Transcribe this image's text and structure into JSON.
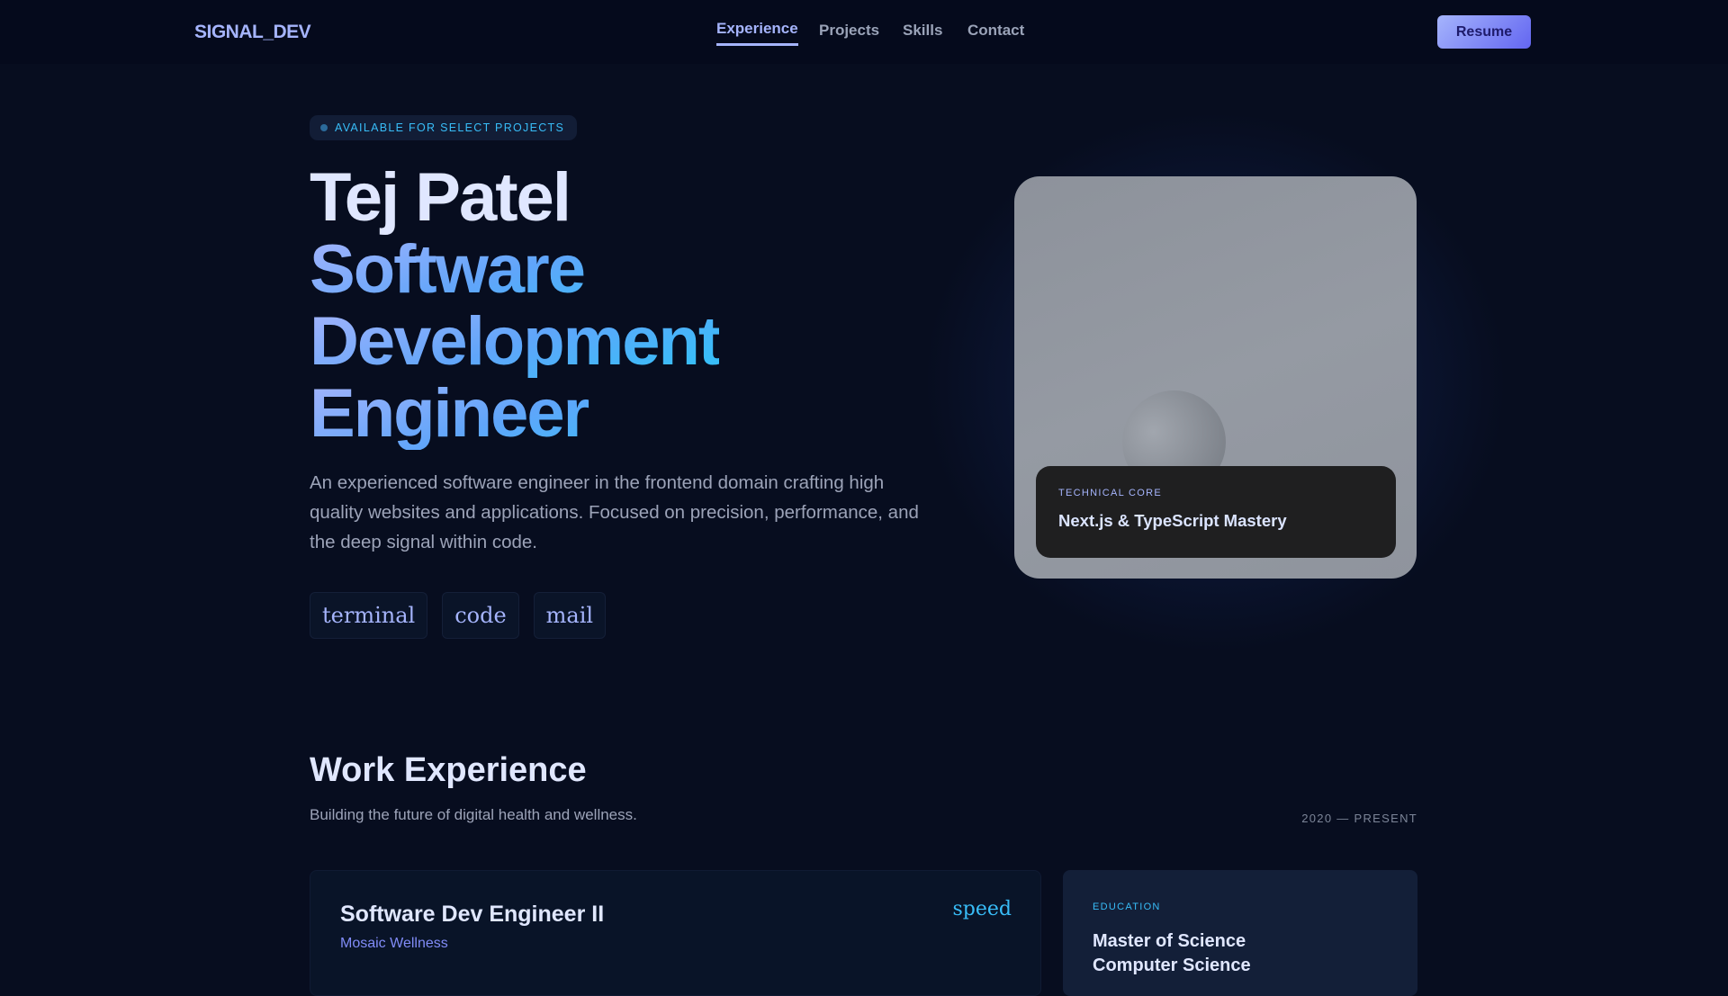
{
  "nav": {
    "logo": "SIGNAL_DEV",
    "links": [
      {
        "label": "Experience",
        "active": true
      },
      {
        "label": "Projects"
      },
      {
        "label": "Skills"
      },
      {
        "label": "Contact"
      }
    ],
    "resume_label": "Resume"
  },
  "hero": {
    "badge": "AVAILABLE FOR SELECT PROJECTS",
    "name": "Tej Patel",
    "role_lines": [
      "Software",
      "Development",
      "Engineer"
    ],
    "description": "An experienced software engineer in the frontend domain crafting high quality websites and applications. Focused on precision, performance, and the deep signal within code.",
    "icon_links": [
      "terminal",
      "code",
      "mail"
    ],
    "card": {
      "label": "TECHNICAL CORE",
      "title": "Next.js & TypeScript Mastery"
    }
  },
  "experience": {
    "title": "Work Experience",
    "subtitle": "Building the future of digital health and wellness.",
    "range": "2020 — PRESENT",
    "jobs": [
      {
        "role": "Software Dev Engineer II",
        "company": "Mosaic Wellness",
        "icon": "speed"
      }
    ],
    "education": {
      "label": "EDUCATION",
      "degree_line1": "Master of Science",
      "degree_line2": "Computer Science"
    }
  },
  "colors": {
    "accent": "#a5b4fc",
    "accent2": "#38bdf8",
    "indigo": "#6366f1",
    "bg": "#070d1f"
  }
}
